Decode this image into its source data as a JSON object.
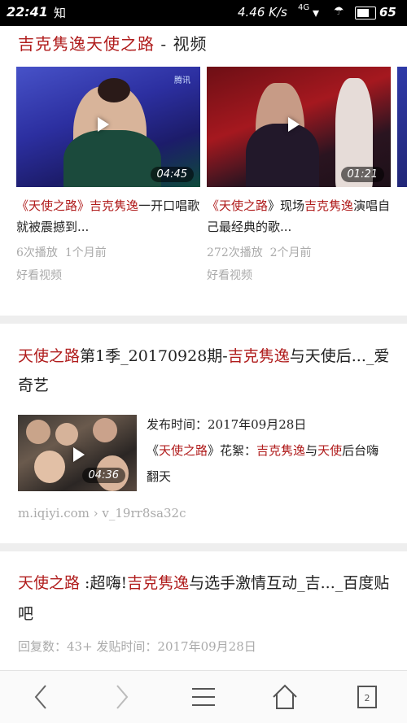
{
  "status_bar": {
    "time": "22:41",
    "left_extra": "知",
    "speed": "4.46 K/s",
    "network": "4G",
    "battery": "65"
  },
  "video_section": {
    "title_highlight": "吉克隽逸天使之路",
    "title_rest": " - 视频",
    "cards": [
      {
        "title_prefix": "《",
        "title_hl1": "天使之路",
        "title_mid": "》",
        "title_hl2": "吉克隽逸",
        "title_rest": "一开口唱歌就被震撼到...",
        "plays": "6次播放",
        "age": "1个月前",
        "source": "好看视频",
        "duration": "04:45",
        "logo": "腾讯"
      },
      {
        "title_prefix": "《",
        "title_hl1": "天使之路",
        "title_mid": "》现场",
        "title_hl2": "吉克隽逸",
        "title_rest": "演唱自己最经典的歌...",
        "plays": "272次播放",
        "age": "2个月前",
        "source": "好看视频",
        "duration": "01:21"
      }
    ]
  },
  "result2": {
    "title_hl1": "天使之路",
    "title_mid": "第1季_20170928期-",
    "title_hl2": "吉克隽逸",
    "title_rest": "与天使后..._爱奇艺",
    "published_label": "发布时间：2017年09月28日",
    "desc_prefix": "《",
    "desc_hl1": "天使之路",
    "desc_mid": "》花絮：",
    "desc_hl2": "吉克隽逸",
    "desc_mid2": "与",
    "desc_hl3": "天使",
    "desc_rest": "后台嗨翻天",
    "duration": "04:36",
    "url": "m.iqiyi.com › v_19rr8sa32c"
  },
  "result3": {
    "title_hl1": "天使之路",
    "title_mid": " :超嗨!",
    "title_hl2": "吉克隽逸",
    "title_rest": "与选手激情互动_吉..._百度贴吧",
    "meta": "回复数：43+  发贴时间：2017年09月28日"
  },
  "bottom_nav": {
    "tab_count": "2"
  }
}
